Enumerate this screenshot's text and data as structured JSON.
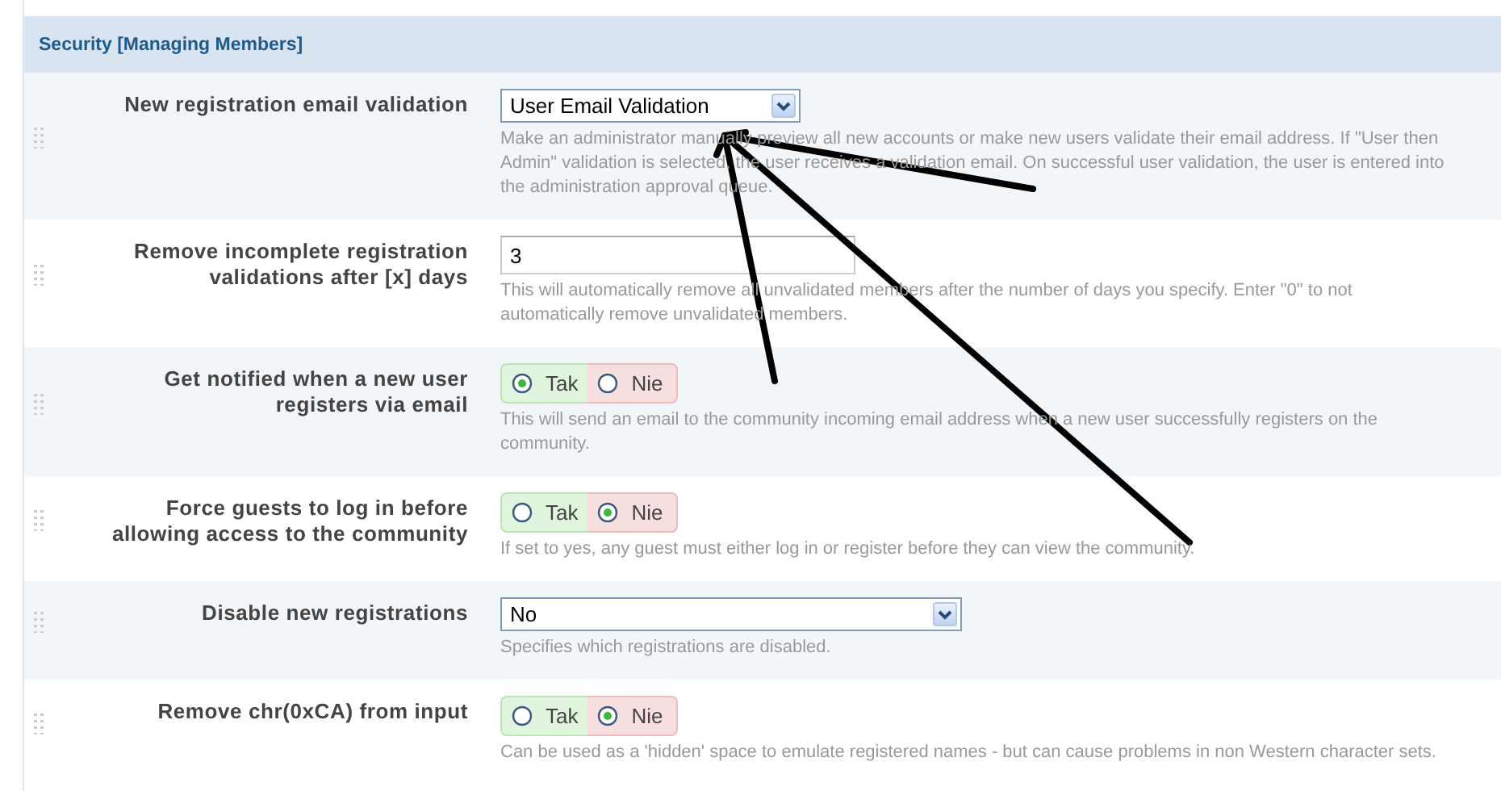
{
  "section": {
    "title": "Security [Managing Members]"
  },
  "settings": [
    {
      "kind": "select",
      "label": "New registration email validation",
      "value": "User Email Validation",
      "description": "Make an administrator manually preview all new accounts or make new users validate their email address. If \"User then Admin\" validation is selected, the user receives a validation email. On successful user validation, the user is entered into the administration approval queue."
    },
    {
      "kind": "text",
      "label": "Remove incomplete registration validations after [x] days",
      "value": "3",
      "description": "This will automatically remove all unvalidated members after the number of days you specify. Enter \"0\" to not automatically remove unvalidated members."
    },
    {
      "kind": "yesno",
      "label": "Get notified when a new user registers via email",
      "options": [
        {
          "label": "Tak",
          "selected": true
        },
        {
          "label": "Nie",
          "selected": false
        }
      ],
      "description": "This will send an email to the community incoming email address when a new user successfully registers on the community."
    },
    {
      "kind": "yesno",
      "label": "Force guests to log in before allowing access to the community",
      "options": [
        {
          "label": "Tak",
          "selected": false
        },
        {
          "label": "Nie",
          "selected": true
        }
      ],
      "description": "If set to yes, any guest must either log in or register before they can view the community."
    },
    {
      "kind": "select-wide",
      "label": "Disable new registrations",
      "value": "No",
      "description": "Specifies which registrations are disabled."
    },
    {
      "kind": "yesno",
      "label": "Remove chr(0xCA) from input",
      "options": [
        {
          "label": "Tak",
          "selected": false
        },
        {
          "label": "Nie",
          "selected": true
        }
      ],
      "description": "Can be used as a 'hidden' space to emulate registered names - but can cause problems in non Western character sets."
    }
  ]
}
